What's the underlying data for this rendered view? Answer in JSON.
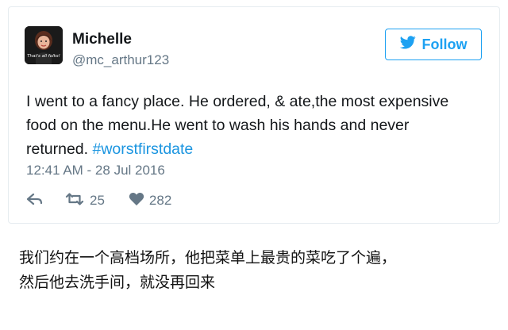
{
  "tweet": {
    "avatar_text": "That's all folks!",
    "display_name": "Michelle",
    "handle": "@mc_arthur123",
    "follow_label": "Follow",
    "text_main": "I went to a fancy place. He ordered, & ate,the most expensive food on the menu.He went to wash his hands and never returned. ",
    "hashtag": "#worstfirstdate",
    "timestamp": "12:41 AM - 28 Jul 2016",
    "retweet_count": "25",
    "like_count": "282",
    "icons": {
      "follow": "twitter-bird-icon",
      "reply": "reply-icon",
      "retweet": "retweet-icon",
      "like": "heart-icon"
    }
  },
  "caption": {
    "line1": "我们约在一个高档场所，他把菜单上最贵的菜吃了个遍，",
    "line2": "然后他去洗手间，就没再回来"
  },
  "colors": {
    "brand_blue": "#1da1f2",
    "hashtag_blue": "#1b95e0",
    "muted_gray": "#657786",
    "text_dark": "#14171a"
  }
}
